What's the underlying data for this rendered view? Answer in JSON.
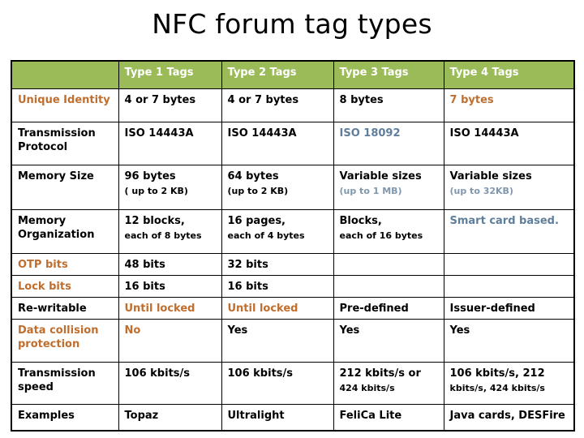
{
  "slide": {
    "title": "NFC forum tag types"
  },
  "colors": {
    "header_green": "#9BBB59",
    "header_text": "#FFFFFF",
    "body_text": "#000000",
    "accent_orange": "#BF6E2E",
    "accent_blue": "#5F7E9B",
    "border": "#000000"
  },
  "table": {
    "columns": [
      {
        "label": "",
        "name": "row-label-column"
      },
      {
        "label": "Type 1 Tags",
        "name": "type-1-tags"
      },
      {
        "label": "Type 2 Tags",
        "name": "type-2-tags"
      },
      {
        "label": "Type 3 Tags",
        "name": "type-3-tags"
      },
      {
        "label": "Type 4 Tags",
        "name": "type-4-tags"
      }
    ],
    "rows": [
      {
        "name": "unique-identity",
        "label": "Unique Identity",
        "label_color": "orange",
        "cells": [
          {
            "main": "4 or 7 bytes",
            "sub": "",
            "color": "black"
          },
          {
            "main": "4 or 7 bytes",
            "sub": "",
            "color": "black"
          },
          {
            "main": "8 bytes",
            "sub": "",
            "color": "black"
          },
          {
            "main": "7 bytes",
            "sub": "",
            "color": "orange"
          }
        ]
      },
      {
        "name": "transmission-protocol",
        "label": "Transmission",
        "label_line2": "Protocol",
        "label_color": "black",
        "cells": [
          {
            "main": "ISO 14443A",
            "sub": "",
            "color": "black"
          },
          {
            "main": "ISO 14443A",
            "sub": "",
            "color": "black"
          },
          {
            "main": "ISO 18092",
            "sub": "",
            "color": "blue"
          },
          {
            "main": "ISO 14443A",
            "sub": "",
            "color": "black"
          }
        ]
      },
      {
        "name": "memory-size",
        "label": "Memory Size",
        "label_color": "black",
        "cells": [
          {
            "main": "96 bytes",
            "sub": "( up to 2 KB)",
            "color": "black",
            "sub_color": "black"
          },
          {
            "main": "64 bytes",
            "sub": "(up to 2 KB)",
            "color": "black",
            "sub_color": "black"
          },
          {
            "main": "Variable sizes",
            "sub": "(up to 1 MB)",
            "color": "black",
            "sub_color": "blue"
          },
          {
            "main": "Variable sizes",
            "sub": "(up to 32KB)",
            "color": "black",
            "sub_color": "blue"
          }
        ]
      },
      {
        "name": "memory-organization",
        "label": "Memory",
        "label_line2": "Organization",
        "label_color": "black",
        "cells": [
          {
            "main": "12 blocks,",
            "sub": "each of 8 bytes",
            "color": "black",
            "sub_color": "black"
          },
          {
            "main": "16 pages,",
            "sub": "each of 4 bytes",
            "color": "black",
            "sub_color": "black"
          },
          {
            "main": "Blocks,",
            "sub": "each of 16 bytes",
            "color": "black",
            "sub_color": "black"
          },
          {
            "main": "Smart card based.",
            "sub": "",
            "color": "blue"
          }
        ]
      },
      {
        "name": "otp-bits",
        "label": "OTP bits",
        "label_color": "orange",
        "cells": [
          {
            "main": "48 bits",
            "sub": "",
            "color": "black"
          },
          {
            "main": "32 bits",
            "sub": "",
            "color": "black"
          },
          {
            "main": "",
            "sub": "",
            "color": "black"
          },
          {
            "main": "",
            "sub": "",
            "color": "black"
          }
        ]
      },
      {
        "name": "lock-bits",
        "label": "Lock bits",
        "label_color": "orange",
        "cells": [
          {
            "main": "16 bits",
            "sub": "",
            "color": "black"
          },
          {
            "main": "16 bits",
            "sub": "",
            "color": "black"
          },
          {
            "main": "",
            "sub": "",
            "color": "black"
          },
          {
            "main": "",
            "sub": "",
            "color": "black"
          }
        ]
      },
      {
        "name": "re-writable",
        "label": "Re-writable",
        "label_color": "black",
        "cells": [
          {
            "main": "Until locked",
            "sub": "",
            "color": "orange"
          },
          {
            "main": "Until locked",
            "sub": "",
            "color": "orange"
          },
          {
            "main": "Pre-defined",
            "sub": "",
            "color": "black"
          },
          {
            "main": "Issuer-defined",
            "sub": "",
            "color": "black"
          }
        ]
      },
      {
        "name": "data-collision-protection",
        "label": "Data collision",
        "label_line2": "protection",
        "label_color": "orange",
        "cells": [
          {
            "main": "No",
            "sub": "",
            "color": "orange"
          },
          {
            "main": "Yes",
            "sub": "",
            "color": "black"
          },
          {
            "main": "Yes",
            "sub": "",
            "color": "black"
          },
          {
            "main": "Yes",
            "sub": "",
            "color": "black"
          }
        ]
      },
      {
        "name": "transmission-speed",
        "label": "Transmission",
        "label_line2": "speed",
        "label_color": "black",
        "cells": [
          {
            "main": "106 kbits/s",
            "sub": "",
            "color": "black"
          },
          {
            "main": "106 kbits/s",
            "sub": "",
            "color": "black"
          },
          {
            "main": "212 kbits/s or",
            "sub": "424 kbits/s",
            "color": "black",
            "sub_color": "black"
          },
          {
            "main": "106 kbits/s, 212",
            "sub": "kbits/s, 424 kbits/s",
            "color": "black",
            "sub_color": "black"
          }
        ]
      },
      {
        "name": "examples",
        "label": "Examples",
        "label_color": "black",
        "cells": [
          {
            "main": "Topaz",
            "sub": "",
            "color": "black"
          },
          {
            "main": "Ultralight",
            "sub": "",
            "color": "black"
          },
          {
            "main": "FeliCa Lite",
            "sub": "",
            "color": "black"
          },
          {
            "main": "Java cards, DESFire",
            "sub": "",
            "color": "black"
          }
        ]
      }
    ]
  }
}
